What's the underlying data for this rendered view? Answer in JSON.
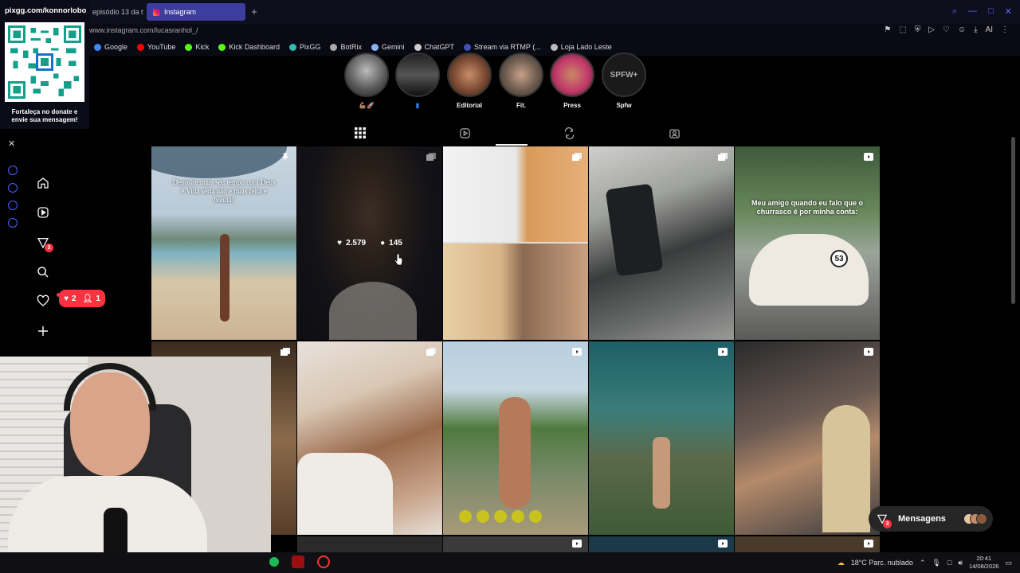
{
  "browser": {
    "tabs": [
      {
        "label": "episódio 13 da t"
      },
      {
        "label": "Instagram",
        "active": true
      }
    ],
    "url": "www.instagram.com/lucasranhol_/",
    "bookmarks": [
      {
        "label": "Google",
        "icon": "google-icon",
        "color": "#4285f4"
      },
      {
        "label": "YouTube",
        "icon": "youtube-icon",
        "color": "#ff0000"
      },
      {
        "label": "Kick",
        "icon": "kick-icon",
        "color": "#53fc18"
      },
      {
        "label": "Kick Dashboard",
        "icon": "kick-icon",
        "color": "#53fc18"
      },
      {
        "label": "PixGG",
        "icon": "pixgg-icon",
        "color": "#32bcad"
      },
      {
        "label": "BotRix",
        "icon": "botrix-icon",
        "color": "#aaaaaa"
      },
      {
        "label": "Gemini",
        "icon": "gemini-icon",
        "color": "#8ab4f8"
      },
      {
        "label": "ChatGPT",
        "icon": "chatgpt-icon",
        "color": "#cccccc"
      },
      {
        "label": "Stream via RTMP (...",
        "icon": "rtmp-icon",
        "color": "#3f51b5"
      },
      {
        "label": "Loja Lado Leste",
        "icon": "store-icon",
        "color": "#bbbbbb"
      }
    ]
  },
  "overlay": {
    "site": "pixgg.com/konnorlobo",
    "donate_text": "Fortaleça no donate e envie sua mensagem!"
  },
  "instagram": {
    "highlights": [
      {
        "label": "💪🏽🚀"
      },
      {
        "label": "▮"
      },
      {
        "label": "Editorial"
      },
      {
        "label": "Fit."
      },
      {
        "label": "Press"
      },
      {
        "label": "Spfw",
        "thumb_text": "SPFW+"
      }
    ],
    "notifications": {
      "likes": "2",
      "followers": "1"
    },
    "dm_badge": "3",
    "posts": [
      {
        "caption": "Deposite mais seu tempo com Deus e Vida séria não é mais feita e bonita!"
      },
      {
        "likes": "2.579",
        "comments": "145"
      },
      {},
      {},
      {
        "caption": "Meu amigo quando eu falo que o churrasco é por minha conta:"
      }
    ],
    "messages_label": "Mensagens"
  },
  "taskbar": {
    "weather": "18°C  Parc. nublado",
    "time": "20:41",
    "date": "14/08/2026"
  }
}
